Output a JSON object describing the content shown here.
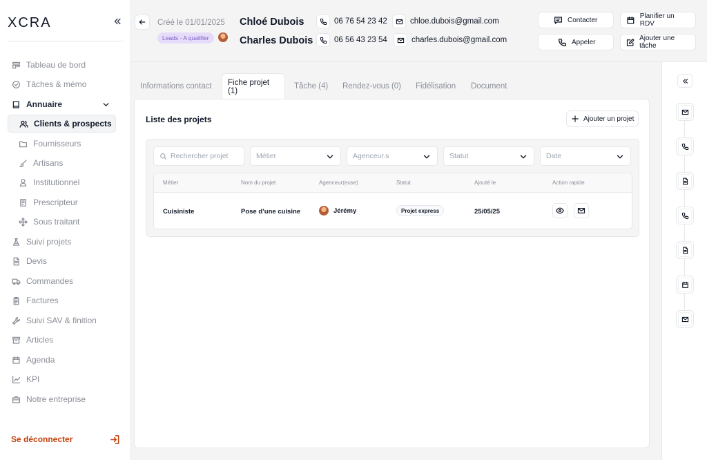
{
  "brand": {
    "logo": "XCRA"
  },
  "sidebar": {
    "items": [
      {
        "label": "Tableau de bord",
        "icon": "dashboard-icon"
      },
      {
        "label": "Tâches & mémo",
        "icon": "check-circle-icon"
      },
      {
        "label": "Annuaire",
        "icon": "book-icon"
      },
      {
        "label": "Clients & prospects",
        "icon": "users-icon"
      },
      {
        "label": "Fournisseurs",
        "icon": "folder-icon"
      },
      {
        "label": "Artisans",
        "icon": "brush-icon"
      },
      {
        "label": "Institutionnel",
        "icon": "person-icon"
      },
      {
        "label": "Prescripteur",
        "icon": "document-icon"
      },
      {
        "label": "Sous traitant",
        "icon": "network-icon"
      },
      {
        "label": "Suivi projets",
        "icon": "flask-icon"
      },
      {
        "label": "Devis",
        "icon": "file-icon"
      },
      {
        "label": "Commandes",
        "icon": "truck-icon"
      },
      {
        "label": "Factures",
        "icon": "clipboard-icon"
      },
      {
        "label": "Suivi SAV & finition",
        "icon": "wrench-icon"
      },
      {
        "label": "Articles",
        "icon": "archive-icon"
      },
      {
        "label": "Agenda",
        "icon": "calendar-icon"
      },
      {
        "label": "KPI",
        "icon": "chart-icon"
      },
      {
        "label": "Notre entreprise",
        "icon": "briefcase-icon"
      }
    ],
    "logout": "Se déconnecter"
  },
  "header": {
    "created": "Créé le 01/01/2025",
    "lead_badge": "Leads - A qualifier",
    "contacts": [
      {
        "name": "Chloé Dubois",
        "phone": "06 76 54 23 42",
        "email": "chloe.dubois@gmail.com"
      },
      {
        "name": "Charles Dubois",
        "phone": "06 56 43 23 54",
        "email": "charles.dubois@gmail.com"
      }
    ],
    "actions": {
      "contact": "Contacter",
      "plan": "Planifier un RDV",
      "call": "Appeler",
      "task": "Ajouter une tâche"
    }
  },
  "tabs": [
    {
      "label": "Informations contact"
    },
    {
      "label": "Fiche projet (1)"
    },
    {
      "label": "Tâche (4)"
    },
    {
      "label": "Rendez-vous (0)"
    },
    {
      "label": "Fidélisation"
    },
    {
      "label": "Document"
    }
  ],
  "projects": {
    "title": "Liste des projets",
    "add_label": "Ajouter un projet",
    "filters": {
      "search_placeholder": "Rechercher projet",
      "metier": "Métier",
      "agenceur": "Agenceur.s",
      "statut": "Statut",
      "date": "Date"
    },
    "columns": [
      "Métier",
      "Nom du projet",
      "Agenceur(euse)",
      "Statut",
      "Ajouté le",
      "Action rapide"
    ],
    "rows": [
      {
        "metier": "Cuisiniste",
        "nom": "Pose d’une cuisine",
        "agenceur": "Jérémy",
        "statut": "Projet express",
        "date": "25/05/25"
      }
    ]
  },
  "rail": {
    "icons": [
      "mail-icon",
      "phone-icon",
      "file-icon",
      "phone-icon",
      "file-icon",
      "calendar-icon",
      "mail-icon"
    ]
  },
  "colors": {
    "lead_badge_bg": "#e6dcfa",
    "lead_badge_text": "#7c5bc4",
    "logout": "#c2410c"
  }
}
